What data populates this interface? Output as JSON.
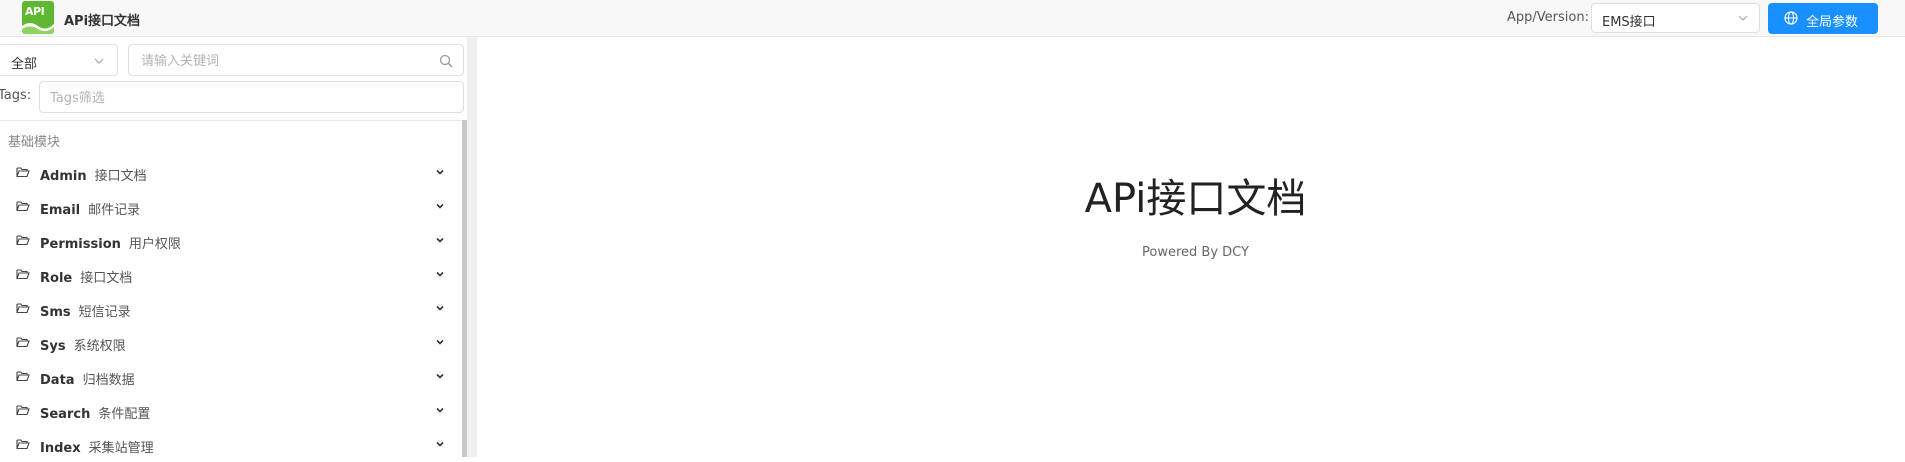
{
  "header": {
    "logo_text": "API",
    "title": "APi接口文档",
    "app_version_label": "App/Version:",
    "app_version_value": "EMS接口",
    "global_params_label": "全局参数",
    "accent_color": "#1890ff",
    "logo_color": "#5fb832"
  },
  "sidebar": {
    "scope_value": "全部",
    "search_placeholder": "请输入关键词",
    "tags_label": "Tags:",
    "tags_placeholder": "Tags筛选",
    "group_label": "基础模块",
    "items": [
      {
        "name": "Admin",
        "desc": "接口文档",
        "icon": "folder-open-icon"
      },
      {
        "name": "Email",
        "desc": "邮件记录",
        "icon": "folder-open-icon"
      },
      {
        "name": "Permission",
        "desc": "用户权限",
        "icon": "folder-open-icon"
      },
      {
        "name": "Role",
        "desc": "接口文档",
        "icon": "folder-open-icon"
      },
      {
        "name": "Sms",
        "desc": "短信记录",
        "icon": "folder-open-icon"
      },
      {
        "name": "Sys",
        "desc": "系统权限",
        "icon": "folder-open-icon"
      },
      {
        "name": "Data",
        "desc": "归档数据",
        "icon": "folder-open-icon"
      },
      {
        "name": "Search",
        "desc": "条件配置",
        "icon": "folder-open-icon"
      },
      {
        "name": "Index",
        "desc": "采集站管理",
        "icon": "folder-open-icon"
      }
    ]
  },
  "main": {
    "title": "APi接口文档",
    "subtitle": "Powered By DCY"
  }
}
